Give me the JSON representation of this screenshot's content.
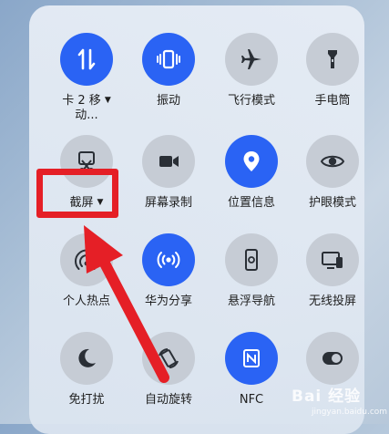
{
  "tiles": [
    {
      "label": "卡 2 移",
      "label2": "动...",
      "caret": "▼",
      "icon": "mobile-data-icon",
      "state": "on"
    },
    {
      "label": "振动",
      "icon": "vibrate-icon",
      "state": "on"
    },
    {
      "label": "飞行模式",
      "icon": "airplane-icon",
      "state": "off"
    },
    {
      "label": "手电筒",
      "icon": "flashlight-icon",
      "state": "off"
    },
    {
      "label": "截屏",
      "caret": "▼",
      "icon": "screenshot-icon",
      "state": "off"
    },
    {
      "label": "屏幕录制",
      "icon": "screen-record-icon",
      "state": "off"
    },
    {
      "label": "位置信息",
      "icon": "location-icon",
      "state": "on"
    },
    {
      "label": "护眼模式",
      "icon": "eye-icon",
      "state": "off"
    },
    {
      "label": "个人热点",
      "icon": "hotspot-icon",
      "state": "off"
    },
    {
      "label": "华为分享",
      "icon": "share-icon",
      "state": "on"
    },
    {
      "label": "悬浮导航",
      "icon": "floating-nav-icon",
      "state": "off"
    },
    {
      "label": "无线投屏",
      "icon": "wireless-projection-icon",
      "state": "off"
    },
    {
      "label": "免打扰",
      "icon": "moon-icon",
      "state": "off"
    },
    {
      "label": "自动旋转",
      "icon": "rotate-icon",
      "state": "off"
    },
    {
      "label": "NFC",
      "icon": "nfc-icon",
      "state": "on"
    },
    {
      "label": "",
      "icon": "toggle-icon",
      "state": "off"
    }
  ],
  "watermark": {
    "text": "Bai 经验",
    "sub": "jingyan.baidu.com"
  },
  "colors": {
    "accent": "#2a63f4",
    "inactive": "#c6ccd5",
    "annotation": "#e51f26"
  }
}
